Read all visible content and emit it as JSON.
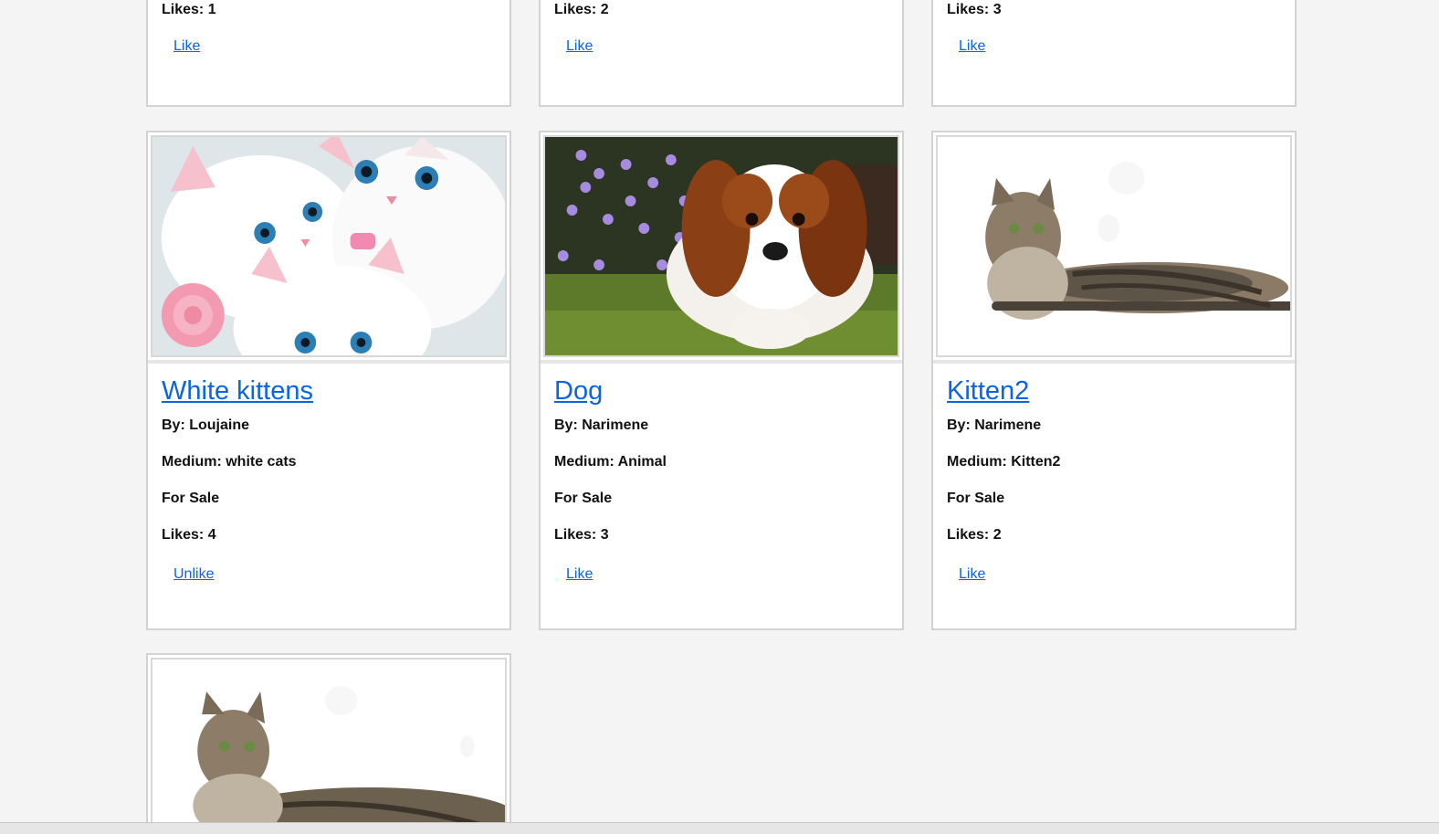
{
  "top_row": [
    {
      "likes": "Likes: 1",
      "action": "Like"
    },
    {
      "likes": "Likes: 2",
      "action": "Like"
    },
    {
      "likes": "Likes: 3",
      "action": "Like"
    }
  ],
  "cards": [
    {
      "title": "White kittens",
      "by": "By: Loujaine",
      "medium": "Medium: white cats",
      "status": "For Sale",
      "likes": "Likes: 4",
      "action": "Unlike",
      "image": "white-kittens-image"
    },
    {
      "title": "Dog",
      "by": "By: Narimene",
      "medium": "Medium: Animal",
      "status": "For Sale",
      "likes": "Likes: 3",
      "action": "Like",
      "image": "puppy-image"
    },
    {
      "title": "Kitten2",
      "by": "By: Narimene",
      "medium": "Medium: Kitten2",
      "status": "For Sale",
      "likes": "Likes: 2",
      "action": "Like",
      "image": "tabby-cat-image"
    }
  ],
  "partial_card": {
    "image": "tabby-cat-image"
  },
  "colors": {
    "link": "#0b63e5",
    "page_bg": "#f4f4f4",
    "card_border": "#d2d2d2"
  }
}
